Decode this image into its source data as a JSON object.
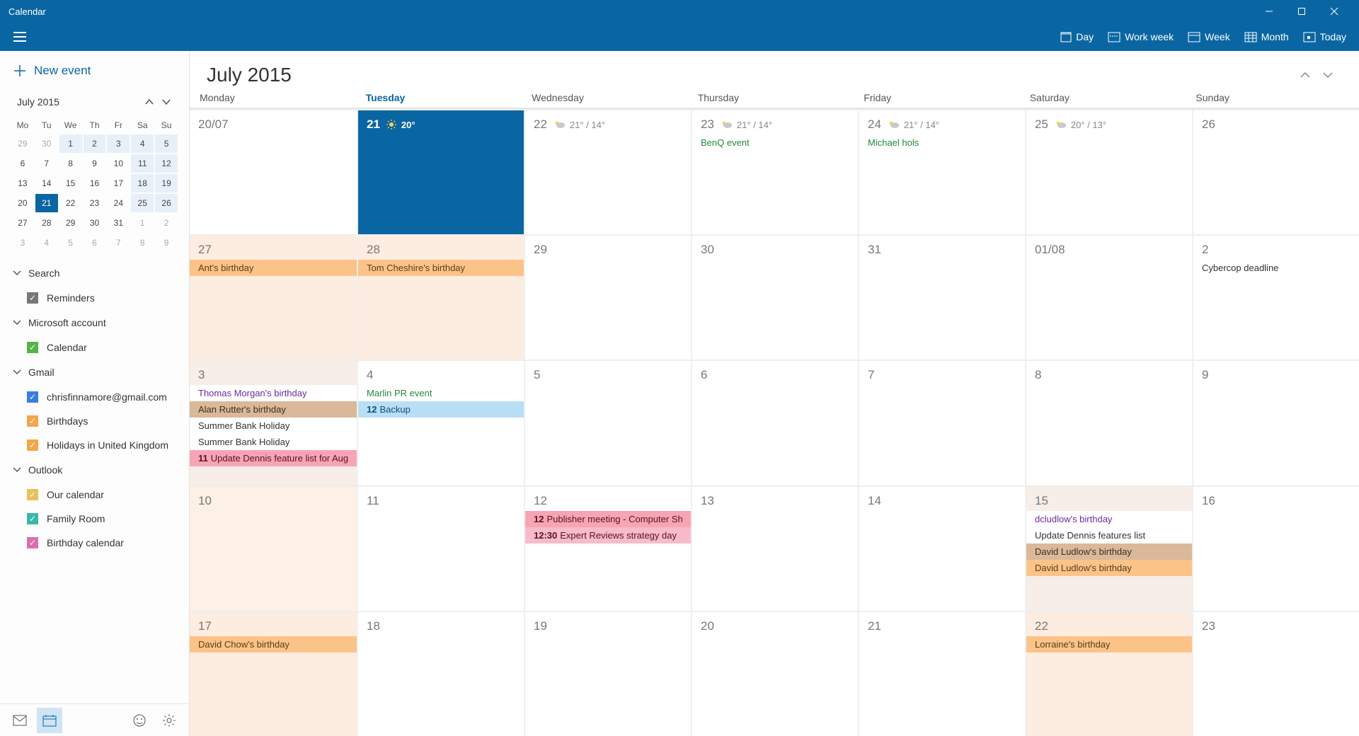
{
  "title": "Calendar",
  "ribbon": {
    "views": [
      "Day",
      "Work week",
      "Week",
      "Month",
      "Today"
    ]
  },
  "sidebar": {
    "new_event": "New event",
    "mini_month": "July 2015",
    "mini_headers": [
      "Mo",
      "Tu",
      "We",
      "Th",
      "Fr",
      "Sa",
      "Su"
    ],
    "mini_days": [
      {
        "n": "29",
        "out": true
      },
      {
        "n": "30",
        "out": true
      },
      {
        "n": "1",
        "tint": true
      },
      {
        "n": "2",
        "tint": true
      },
      {
        "n": "3",
        "tint": true
      },
      {
        "n": "4",
        "tint": true
      },
      {
        "n": "5",
        "tint": true
      },
      {
        "n": "6"
      },
      {
        "n": "7"
      },
      {
        "n": "8"
      },
      {
        "n": "9"
      },
      {
        "n": "10"
      },
      {
        "n": "11",
        "tint": true
      },
      {
        "n": "12",
        "tint": true
      },
      {
        "n": "13"
      },
      {
        "n": "14"
      },
      {
        "n": "15"
      },
      {
        "n": "16"
      },
      {
        "n": "17"
      },
      {
        "n": "18",
        "tint": true
      },
      {
        "n": "19",
        "tint": true
      },
      {
        "n": "20"
      },
      {
        "n": "21",
        "today": true
      },
      {
        "n": "22"
      },
      {
        "n": "23"
      },
      {
        "n": "24"
      },
      {
        "n": "25",
        "tint": true
      },
      {
        "n": "26",
        "tint": true
      },
      {
        "n": "27"
      },
      {
        "n": "28"
      },
      {
        "n": "29"
      },
      {
        "n": "30"
      },
      {
        "n": "31"
      },
      {
        "n": "1",
        "out": true
      },
      {
        "n": "2",
        "out": true
      },
      {
        "n": "3",
        "out": true
      },
      {
        "n": "4",
        "out": true
      },
      {
        "n": "5",
        "out": true
      },
      {
        "n": "6",
        "out": true
      },
      {
        "n": "7",
        "out": true
      },
      {
        "n": "8",
        "out": true
      },
      {
        "n": "9",
        "out": true
      }
    ],
    "sections": [
      {
        "label": "Search",
        "items": [
          {
            "label": "Reminders",
            "color": "grey"
          }
        ]
      },
      {
        "label": "Microsoft account",
        "items": [
          {
            "label": "Calendar",
            "color": "green"
          }
        ]
      },
      {
        "label": "Gmail",
        "items": [
          {
            "label": "chrisfinnamore@gmail.com",
            "color": "blue"
          },
          {
            "label": "Birthdays",
            "color": "orange"
          },
          {
            "label": "Holidays in United Kingdom",
            "color": "orange"
          }
        ]
      },
      {
        "label": "Outlook",
        "items": [
          {
            "label": "Our calendar",
            "color": "yellow"
          },
          {
            "label": "Family Room",
            "color": "teal"
          },
          {
            "label": "Birthday calendar",
            "color": "pink"
          }
        ]
      }
    ]
  },
  "main": {
    "month_title": "July 2015",
    "day_headers": [
      "Monday",
      "Tuesday",
      "Wednesday",
      "Thursday",
      "Friday",
      "Saturday",
      "Sunday"
    ],
    "today_col": 1,
    "cells": [
      {
        "num": "20/07"
      },
      {
        "num": "21",
        "today": true,
        "weather": "20°",
        "wicon": "sun"
      },
      {
        "num": "22",
        "weather": "21° / 14°",
        "wicon": "cloud"
      },
      {
        "num": "23",
        "weather": "21° / 14°",
        "wicon": "cloud",
        "events": [
          {
            "text": "BenQ event",
            "style": "green"
          }
        ]
      },
      {
        "num": "24",
        "weather": "21° / 14°",
        "wicon": "cloud",
        "events": [
          {
            "text": "Michael hols",
            "style": "green"
          }
        ]
      },
      {
        "num": "25",
        "weather": "20° / 13°",
        "wicon": "cloud"
      },
      {
        "num": "26"
      },
      {
        "num": "27",
        "tint": "orange",
        "events": [
          {
            "text": "Ant's birthday",
            "style": "orange"
          }
        ]
      },
      {
        "num": "28",
        "tint": "orange",
        "events": [
          {
            "text": "Tom Cheshire's birthday",
            "style": "orange"
          }
        ]
      },
      {
        "num": "29"
      },
      {
        "num": "30"
      },
      {
        "num": "31"
      },
      {
        "num": "01/08"
      },
      {
        "num": "2",
        "events": [
          {
            "text": "Cybercop deadline",
            "style": "white"
          }
        ]
      },
      {
        "num": "3",
        "tint": "beige",
        "events": [
          {
            "text": "Thomas Morgan's birthday",
            "style": "purple"
          },
          {
            "text": "Alan Rutter's birthday",
            "style": "brown"
          },
          {
            "text": "Summer Bank Holiday",
            "style": "white"
          },
          {
            "text": "Summer Bank Holiday",
            "style": "white"
          },
          {
            "time": "11",
            "text": "Update Dennis feature list for Aug",
            "style": "pink"
          }
        ]
      },
      {
        "num": "4",
        "events": [
          {
            "text": "Marlin PR event",
            "style": "green"
          },
          {
            "time": "12",
            "text": "Backup",
            "style": "lblue"
          }
        ]
      },
      {
        "num": "5"
      },
      {
        "num": "6"
      },
      {
        "num": "7"
      },
      {
        "num": "8"
      },
      {
        "num": "9"
      },
      {
        "num": "10",
        "tint": "peach"
      },
      {
        "num": "11"
      },
      {
        "num": "12",
        "events": [
          {
            "time": "12",
            "text": "Publisher meeting - Computer Sh",
            "style": "pink"
          },
          {
            "time": "12:30",
            "text": "Expert Reviews strategy day",
            "style": "pink2"
          }
        ]
      },
      {
        "num": "13"
      },
      {
        "num": "14"
      },
      {
        "num": "15",
        "tint": "beige",
        "events": [
          {
            "text": "dcludlow's birthday",
            "style": "purple"
          },
          {
            "text": "Update Dennis features list",
            "style": "white"
          },
          {
            "text": "David Ludlow's birthday",
            "style": "brown"
          },
          {
            "text": "David Ludlow's birthday",
            "style": "orange"
          }
        ]
      },
      {
        "num": "16"
      },
      {
        "num": "17",
        "tint": "orange",
        "events": [
          {
            "text": "David Chow's birthday",
            "style": "orange"
          }
        ]
      },
      {
        "num": "18"
      },
      {
        "num": "19"
      },
      {
        "num": "20"
      },
      {
        "num": "21"
      },
      {
        "num": "22",
        "tint": "orange",
        "events": [
          {
            "text": "Lorraine's birthday",
            "style": "orange"
          }
        ]
      },
      {
        "num": "23"
      }
    ]
  }
}
